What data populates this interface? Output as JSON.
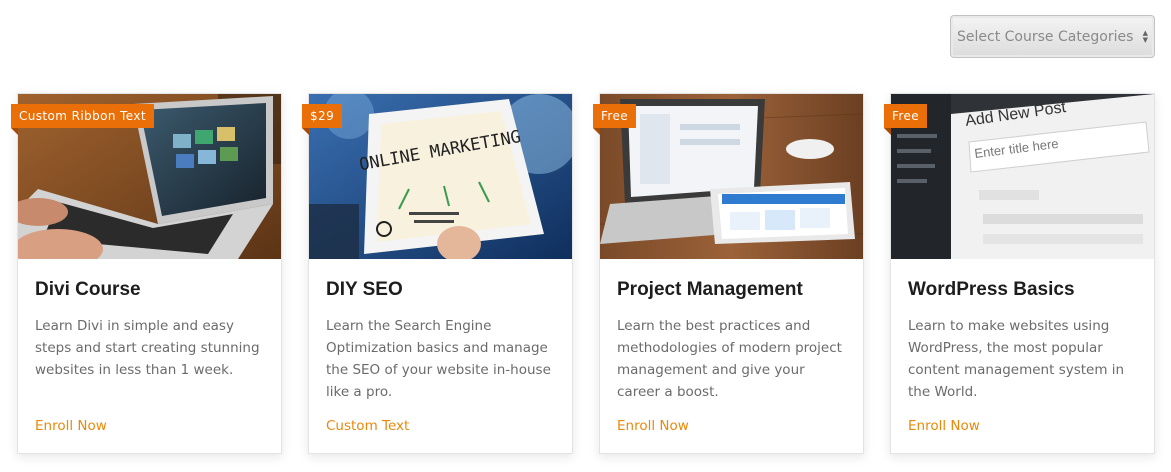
{
  "filter": {
    "select_label": "Select Course Categories",
    "arrow_up": "▲",
    "arrow_down": "▼"
  },
  "colors": {
    "ribbon": "#ea6f08",
    "link": "#e8890c",
    "title": "#1d1d1d",
    "description": "#6b6b6b"
  },
  "courses": [
    {
      "ribbon": "Custom Ribbon Text",
      "title": "Divi Course",
      "description": "Learn Divi in simple and easy steps and start creating stunning websites in less than 1 week.",
      "link": "Enroll Now",
      "image": "laptop-on-desk-photo"
    },
    {
      "ribbon": "$29",
      "title": "DIY SEO",
      "description": "Learn the Search Engine Optimization basics and manage the SEO of your website in-house like a pro.",
      "link": "Custom Text",
      "image": "online-marketing-tablet-photo",
      "image_text": "ONLINE MARKETING"
    },
    {
      "ribbon": "Free",
      "title": "Project Management",
      "description": "Learn the best practices and methodologies of modern project management and give your career a boost.",
      "link": "Enroll Now",
      "image": "laptop-and-tablet-photo"
    },
    {
      "ribbon": "Free",
      "title": "WordPress Basics",
      "description": "Learn to make websites using WordPress, the most popular content management system in the World.",
      "link": "Enroll Now",
      "image": "wordpress-editor-screenshot-photo",
      "image_text": "Add New Post",
      "image_subtext": "Enter title here"
    }
  ]
}
